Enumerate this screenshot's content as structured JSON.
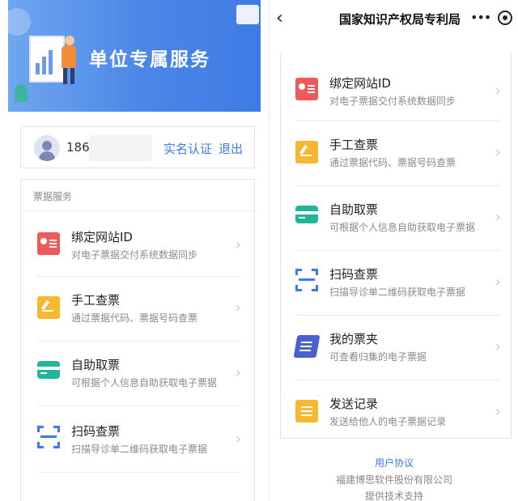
{
  "left": {
    "banner": {
      "title": "单位专属服务"
    },
    "user": {
      "phone": "1861",
      "verify_label": "实名认证",
      "logout_label": "退出"
    },
    "section_title": "票据服务",
    "items": [
      {
        "title": "绑定网站ID",
        "desc": "对电子票据交付系统数据同步",
        "icon": "id-card-icon"
      },
      {
        "title": "手工查票",
        "desc": "通过票据代码、票据号码查票",
        "icon": "manual-edit-icon"
      },
      {
        "title": "自助取票",
        "desc": "可根据个人信息自助获取电子票据",
        "icon": "card-icon"
      },
      {
        "title": "扫码查票",
        "desc": "扫描导诊单二维码获取电子票据",
        "icon": "scan-icon"
      }
    ]
  },
  "right": {
    "nav": {
      "title": "国家知识产权局专利局",
      "back": "‹",
      "more": "•••"
    },
    "items": [
      {
        "title": "绑定网站ID",
        "desc": "对电子票据交付系统数据同步",
        "icon": "id-card-icon"
      },
      {
        "title": "手工查票",
        "desc": "通过票据代码、票据号码查票",
        "icon": "manual-edit-icon"
      },
      {
        "title": "自助取票",
        "desc": "可根据个人信息自助获取电子票据",
        "icon": "card-icon"
      },
      {
        "title": "扫码查票",
        "desc": "扫描导诊单二维码获取电子票据",
        "icon": "scan-icon"
      },
      {
        "title": "我的票夹",
        "desc": "可查看归集的电子票据",
        "icon": "folder-icon"
      },
      {
        "title": "发送记录",
        "desc": "发送给他人的电子票据记录",
        "icon": "send-record-icon"
      }
    ],
    "footer": {
      "agreement": "用户协议",
      "company": "福建博思软件股份有限公司",
      "support": "提供技术支持"
    }
  },
  "arrow": "›",
  "colors": {
    "accent": "#3b7de8",
    "banner": "#4b86e8",
    "id_icon": "#ee5a5a",
    "manual_icon": "#f5b82e",
    "self_icon": "#21b59a",
    "folder_icon": "#4a5fd0"
  }
}
